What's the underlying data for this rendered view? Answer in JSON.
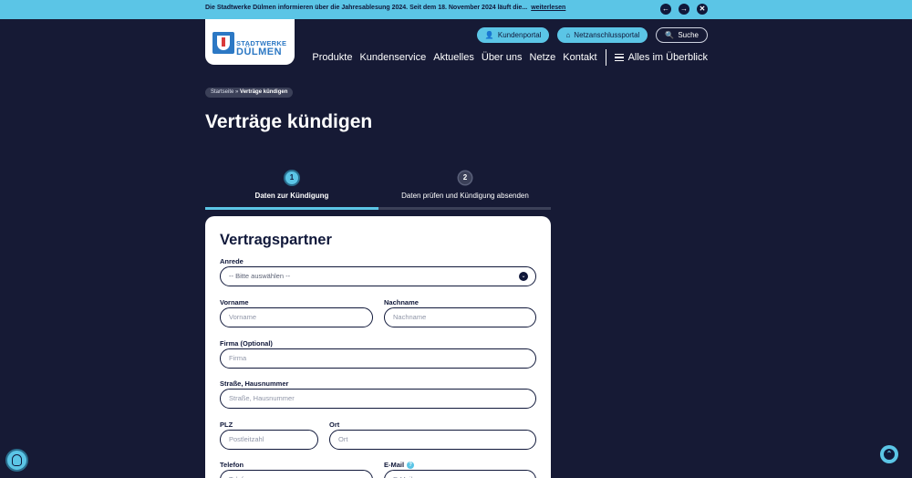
{
  "topbar": {
    "text": "Die Stadtwerke Dülmen informieren über die Jahresablesung 2024. Seit dem 18. November 2024 läuft die...",
    "link": "weiterlesen",
    "prev_icon": "←",
    "next_icon": "→",
    "close_icon": "✕"
  },
  "logo": {
    "line1": "STADTWERKE",
    "line2": "DÜLMEN"
  },
  "quicklinks": {
    "kundenportal": "Kundenportal",
    "netzanschluss": "Netzanschlussportal",
    "suche": "Suche",
    "user_icon": "👤",
    "house_icon": "⌂",
    "search_icon": "🔍"
  },
  "nav": {
    "items": [
      "Produkte",
      "Kundenservice",
      "Aktuelles",
      "Über uns",
      "Netze",
      "Kontakt"
    ],
    "all": "Alles im Überblick"
  },
  "breadcrumb": {
    "home": "Startseite",
    "sep": "»",
    "current": "Verträge kündigen"
  },
  "page_title": "Verträge kündigen",
  "steps": [
    {
      "num": "1",
      "label": "Daten zur Kündigung",
      "active": true
    },
    {
      "num": "2",
      "label": "Daten prüfen und Kündigung absenden",
      "active": false
    }
  ],
  "form": {
    "heading": "Vertragspartner",
    "anrede": {
      "label": "Anrede",
      "value": "-- Bitte auswählen --",
      "chevron": "⌄"
    },
    "vorname": {
      "label": "Vorname",
      "placeholder": "Vorname"
    },
    "nachname": {
      "label": "Nachname",
      "placeholder": "Nachname"
    },
    "firma": {
      "label": "Firma (Optional)",
      "placeholder": "Firma"
    },
    "strasse": {
      "label": "Straße, Hausnummer",
      "placeholder": "Straße, Hausnummer"
    },
    "plz": {
      "label": "PLZ",
      "placeholder": "Postleitzahl"
    },
    "ort": {
      "label": "Ort",
      "placeholder": "Ort"
    },
    "telefon": {
      "label": "Telefon",
      "placeholder": "Telefon"
    },
    "email": {
      "label": "E-Mail",
      "placeholder": "E-Mail",
      "info": "?"
    }
  },
  "fab": {
    "scroll_top_icon": "⌃"
  },
  "colors": {
    "background": "#161a35",
    "accent": "#5bc5e6",
    "text_dark": "#10183a"
  }
}
